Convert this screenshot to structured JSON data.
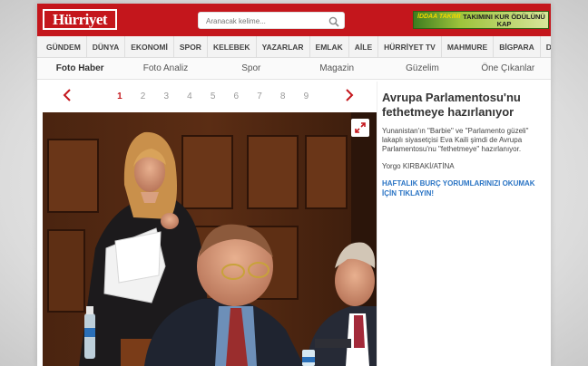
{
  "header": {
    "logo": "Hürriyet",
    "search_placeholder": "Aranacak kelime...",
    "ad_left": "İDDAA TAKIMI",
    "ad_text": "TAKIMINI KUR ÖDÜLÜNÜ KAP"
  },
  "nav": {
    "items": [
      "GÜNDEM",
      "DÜNYA",
      "EKONOMİ",
      "SPOR",
      "KELEBEK",
      "YAZARLAR",
      "EMLAK",
      "AİLE",
      "HÜRRİYET TV",
      "MAHMURE",
      "BİGPARA",
      "DİĞER"
    ]
  },
  "subnav": {
    "items": [
      "Foto Haber",
      "Foto Analiz",
      "Spor",
      "Magazin",
      "Güzelim",
      "Öne Çıkanlar"
    ],
    "active": "Foto Haber"
  },
  "pager": {
    "pages": [
      "1",
      "2",
      "3",
      "4",
      "5",
      "6",
      "7",
      "8",
      "9"
    ],
    "current": "1"
  },
  "article": {
    "headline": "Avrupa Parlamentosu'nu fethetmeye hazırlanıyor",
    "summary": "Yunanistan'ın \"Barbie\" ve \"Parlamento güzeli\" lakaplı siyasetçisi Eva Kaili şimdi de Avrupa Parlamentosu'nu \"fethetmeye\" hazırlanıyor.",
    "author": "Yorgo KIRBAKİ/ATİNA",
    "promo": "HAFTALIK BURÇ YORUMLARINIZI OKUMAK İÇİN TIKLAYIN!"
  },
  "colors": {
    "brand": "#c4161c",
    "link": "#2a74c4"
  }
}
